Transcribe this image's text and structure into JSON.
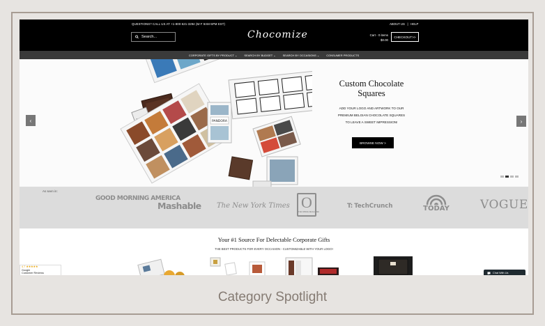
{
  "topbar": {
    "question_text": "QUESTIONS?  CALL US AT +1-800-621-3294 (M-F 9AM-5PM EST)",
    "about_label": "ABOUT US",
    "help_label": "HELP",
    "search_placeholder": "Search...",
    "logo_text": "Chocomize",
    "cart_line1": "Cart - 0 items",
    "cart_line2": "$0.00",
    "checkout_label": "CHECKOUT>>"
  },
  "nav": {
    "items": [
      {
        "label": "CORPORATE GIFTS BY PRODUCT ⌄"
      },
      {
        "label": "SEARCH BY BUDGET ⌄"
      },
      {
        "label": "SEARCH BY OCCASIONS ⌄"
      },
      {
        "label": "CONSUMER PRODUCTS"
      }
    ]
  },
  "hero": {
    "title": "Custom Chocolate Squares",
    "subtitle_line1": "ADD YOUR LOGO AND ARTWORK TO OUR",
    "subtitle_line2": "PREMIUM BELGIAN CHOCOLATE SQUARES",
    "subtitle_line3": "TO LEAVE A SWEET IMPRESSION!",
    "button_label": "BROWSE NOW >",
    "prev_icon": "‹",
    "next_icon": "›",
    "slide_count": 4,
    "active_slide": 2
  },
  "press": {
    "label": "As seen in:",
    "gma": "GOOD MORNING AMERICA",
    "mashable": "Mashable",
    "nyt": "The New York Times",
    "oprah_o": "O",
    "oprah_sub": "THE OPRAH MAGAZINE",
    "techcrunch": "TechCrunch",
    "today": "TODAY",
    "vogue": "VOGUE"
  },
  "bottom": {
    "title": "Your #1 Source For Delectable Corporate Gifts",
    "subtitle": "THE BEST PRODUCTS FOR EVERY OCCASION - CUSTOMIZABLE WITH YOUR LOGO!",
    "reviews_rating": "4.7 ★★★★★",
    "reviews_line2": "Google",
    "reviews_line3": "Customer Reviews",
    "chat_label": "Chat With Us"
  },
  "caption": "Category Spotlight",
  "colors": {
    "frame_border": "#a79c93",
    "frame_bg": "#e7e4e1",
    "topbar_bg": "#000000",
    "nav_bg": "#3a3a3a",
    "press_bg": "#dcdcdc",
    "caption": "#857b73"
  }
}
